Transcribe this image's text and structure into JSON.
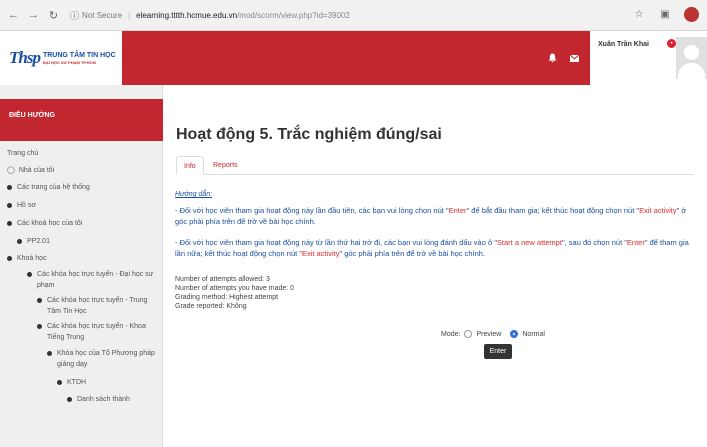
{
  "browser": {
    "secure_label": "Not Secure",
    "url_host": "elearning.tttth.hcmue.edu.vn",
    "url_path": "/mod/scorm/view.php?id=39002"
  },
  "header": {
    "logo_mark": "Thsp",
    "brand_main": "TRUNG TÂM TIN HỌC",
    "brand_sub": "ĐẠI HỌC SƯ PHẠM TP.HCM",
    "user_name": "Xuân Trần Khai"
  },
  "sidebar": {
    "heading": "ĐIỀU HƯỚNG",
    "items": [
      {
        "label": "Trang chủ"
      },
      {
        "label": "Nhà của tôi"
      },
      {
        "label": "Các trang của hệ thống"
      },
      {
        "label": "Hồ sơ"
      },
      {
        "label": "Các khoá học của tôi"
      },
      {
        "label": "PP2.01"
      },
      {
        "label": "Khoá học"
      },
      {
        "label": "Các khóa học trực tuyến - Đại học sư phạm"
      },
      {
        "label": "Các khóa học trực tuyến - Trung Tâm Tin Học"
      },
      {
        "label": "Các khóa học trực tuyến - Khoa Tiếng Trung"
      },
      {
        "label": "Khóa học của Tổ Phương pháp giảng dạy"
      },
      {
        "label": "KTDH"
      },
      {
        "label": "Danh sách thành"
      }
    ]
  },
  "main": {
    "title": "Hoạt động 5. Trắc nghiệm đúng/sai",
    "tabs": [
      {
        "label": "Info"
      },
      {
        "label": "Reports"
      }
    ],
    "guide_label": "Hướng dẫn:",
    "para1": {
      "a": "- Đối với học viên tham gia hoạt động này lần đầu tiên, các bạn vui lòng chọn nút \"",
      "b": "Enter",
      "c": "\" để bắt đầu tham gia; kết thúc hoạt động chọn nút \"",
      "d": "Exit activity",
      "e": "\" ở góc phải phía trên để trở về bài học chính."
    },
    "para2": {
      "a": "- Đối với học viên tham gia hoạt động này từ lần thứ hai trở đi, các bạn vui lòng đánh dấu vào ô \"",
      "b": "Start a new attempt",
      "c": "\", sau đó chọn nút \"",
      "d": "Enter",
      "e": "\" để tham gia lần nữa; kết thúc hoạt động chọn nút \"",
      "f": "Exit activity",
      "g": "\" góc phải phía trên để trở về bài học chính."
    },
    "info_lines": [
      "Number of attempts allowed: 3",
      "Number of attempts you have made: 0",
      "Grading method: Highest attempt",
      "Grade reported: Không"
    ],
    "mode_label": "Mode:",
    "mode_options": [
      {
        "label": "Preview",
        "selected": false
      },
      {
        "label": "Normal",
        "selected": true
      }
    ],
    "enter_label": "Enter"
  }
}
